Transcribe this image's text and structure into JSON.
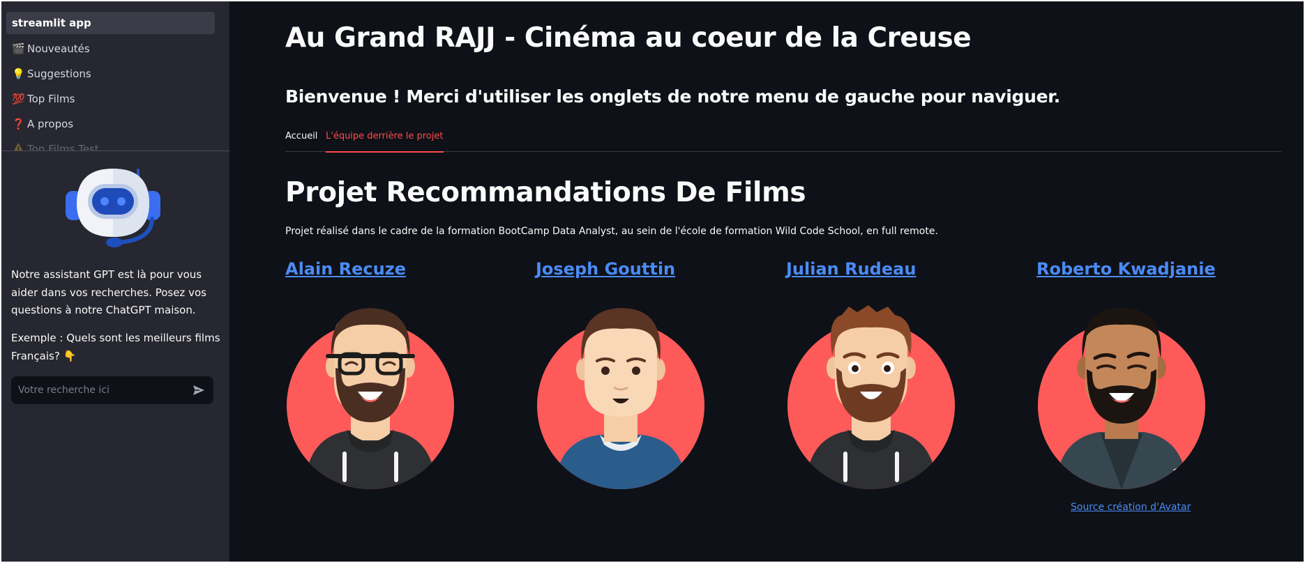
{
  "sidebar": {
    "app_label": "streamlit app",
    "nav": [
      {
        "icon": "clapper-board-icon",
        "emoji": "🎬",
        "label": "Nouveautés"
      },
      {
        "icon": "light-bulb-icon",
        "emoji": "💡",
        "label": "Suggestions"
      },
      {
        "icon": "hundred-points-icon",
        "emoji": "💯",
        "label": "Top Films"
      },
      {
        "icon": "question-mark-icon",
        "emoji": "❓",
        "label": "A propos"
      },
      {
        "icon": "warning-icon",
        "emoji": "⚠️",
        "label": "Top Films Test"
      }
    ],
    "assistant_text": "Notre assistant GPT est là pour vous aider dans vos recherches. Posez vos questions à notre ChatGPT maison.",
    "example_text": "Exemple : Quels sont les meilleurs films Français? 👇",
    "chat_placeholder": "Votre recherche ici"
  },
  "main": {
    "title": "Au Grand RAJJ - Cinéma au coeur de la Creuse",
    "welcome": "Bienvenue ! Merci d'utiliser les onglets de notre menu de gauche pour naviguer.",
    "tabs": [
      {
        "label": "Accueil",
        "active": false
      },
      {
        "label": "L'équipe derrière le projet",
        "active": true
      }
    ],
    "project_title": "Projet Recommandations De Films",
    "project_desc": "Projet réalisé dans le cadre de la formation BootCamp Data Analyst, au sein de l'école de formation Wild Code School, en full remote.",
    "team": [
      {
        "name": "Alain Recuze"
      },
      {
        "name": "Joseph Gouttin"
      },
      {
        "name": "Julian Rudeau"
      },
      {
        "name": "Roberto Kwadjanie"
      }
    ],
    "avatar_source_link": "Source création d'Avatar"
  },
  "colors": {
    "background": "#0e1117",
    "sidebar": "#262730",
    "accent": "#ff4b4b",
    "link": "#4b8bf5",
    "avatar_circle": "#ff5a5a"
  }
}
